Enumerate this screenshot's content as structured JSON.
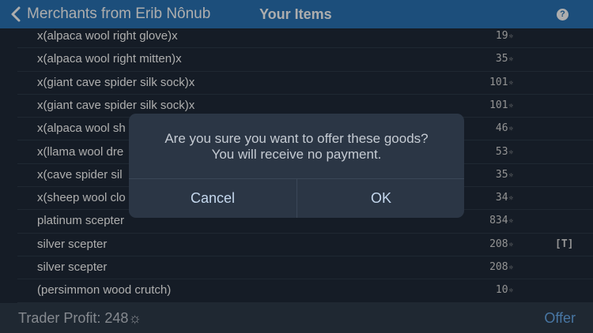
{
  "navbar": {
    "back_label": "Merchants from Erib Nônub",
    "title": "Your Items",
    "help_label": "?"
  },
  "items": [
    {
      "name": "x(alpaca wool right glove)x",
      "value": "19",
      "tag": ""
    },
    {
      "name": "x(alpaca wool right mitten)x",
      "value": "35",
      "tag": ""
    },
    {
      "name": "x(giant cave spider silk sock)x",
      "value": "101",
      "tag": ""
    },
    {
      "name": "x(giant cave spider silk sock)x",
      "value": "101",
      "tag": ""
    },
    {
      "name": "x(alpaca wool sh",
      "value": "46",
      "tag": ""
    },
    {
      "name": "x(llama wool dre",
      "value": "53",
      "tag": ""
    },
    {
      "name": "x(cave spider sil",
      "value": "35",
      "tag": ""
    },
    {
      "name": "x(sheep wool clo",
      "value": "34",
      "tag": ""
    },
    {
      "name": "platinum scepter",
      "value": "834",
      "tag": ""
    },
    {
      "name": "silver scepter",
      "value": "208",
      "tag": "[T]"
    },
    {
      "name": "silver scepter",
      "value": "208",
      "tag": ""
    },
    {
      "name": "(persimmon wood crutch)",
      "value": "10",
      "tag": ""
    }
  ],
  "currency_symbol": "☼",
  "footer": {
    "profit_label": "Trader Profit: 248☼",
    "offer_label": "Offer"
  },
  "dialog": {
    "line1": "Are you sure you want to offer these goods?",
    "line2": "You will receive no payment.",
    "cancel_label": "Cancel",
    "ok_label": "OK"
  },
  "colors": {
    "navbar": "#2a74b5",
    "background": "#1f2a38",
    "accent": "#6aaef0"
  }
}
